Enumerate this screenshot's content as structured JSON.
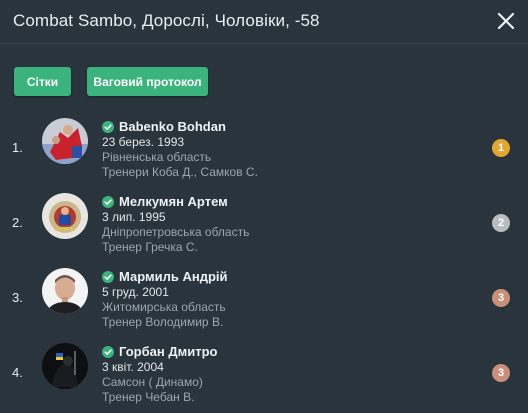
{
  "header": {
    "title": "Combat Sambo, Дорослі, Чоловіки, -58"
  },
  "buttons": {
    "grids": "Сітки",
    "protocol": "Ваговий протокол"
  },
  "colors": {
    "gold": "#e3a630",
    "silver": "#b9bcbf",
    "bronze": "#c98f78",
    "check": "#3bb37c",
    "button": "#3bb37c"
  },
  "athletes": [
    {
      "rank": "1.",
      "name": "Babenko Bohdan",
      "dob": "23 берез. 1993",
      "region": "Рівненська область",
      "coach": "Тренери Коба Д.,  Самков С.",
      "place": "1"
    },
    {
      "rank": "2.",
      "name": "Мелкумян Артем",
      "dob": "3 лип. 1995",
      "region": "Дніпропетровська область",
      "coach": "Тренер Гречка С.",
      "place": "2"
    },
    {
      "rank": "3.",
      "name": "Мармиль Андрій",
      "dob": "5 груд. 2001",
      "region": "Житомирська область",
      "coach": "Тренер Володимир В.",
      "place": "3"
    },
    {
      "rank": "4.",
      "name": "Горбан Дмитро",
      "dob": "3 квіт. 2004",
      "region": "Самсон ( Динамо)",
      "coach": "Тренер Чебан В.",
      "place": "3"
    }
  ]
}
